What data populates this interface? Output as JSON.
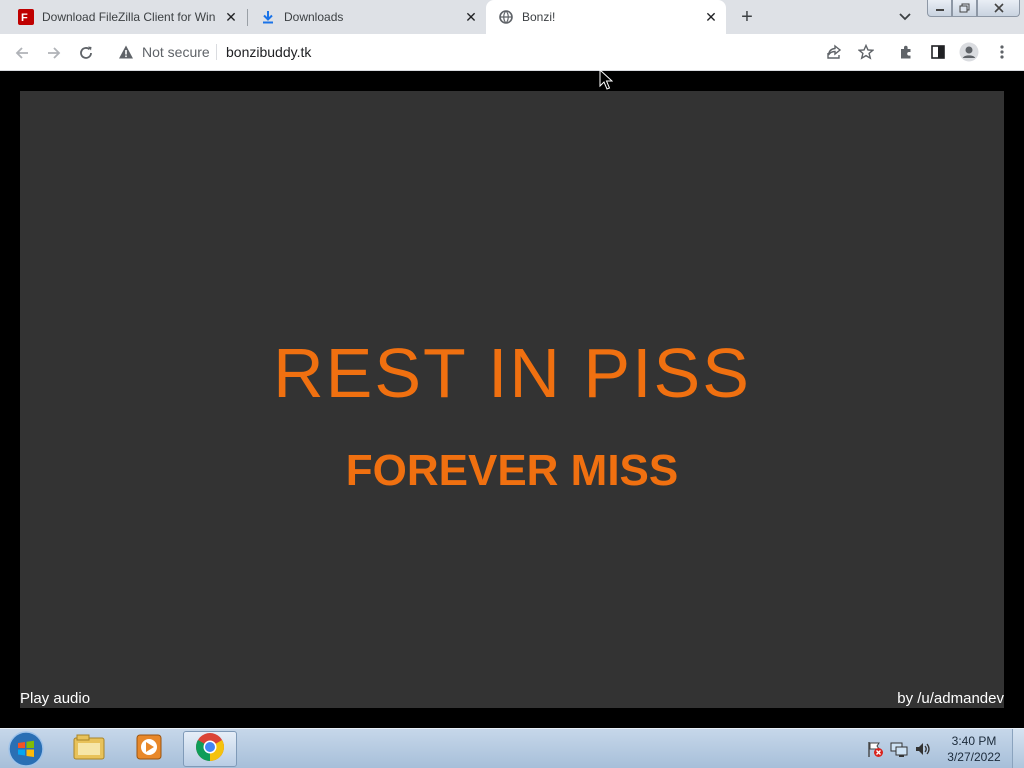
{
  "tabs": [
    {
      "title": "Download FileZilla Client for Win",
      "icon": "filezilla-icon"
    },
    {
      "title": "Downloads",
      "icon": "download-icon"
    },
    {
      "title": "Bonzi!",
      "icon": "globe-icon"
    }
  ],
  "address_bar": {
    "security_label": "Not secure",
    "url": "bonzibuddy.tk"
  },
  "page": {
    "headline": "REST IN PISS",
    "subheadline": "FOREVER MISS",
    "play_audio": "Play audio",
    "credit": "by /u/admandev"
  },
  "colors": {
    "accent_orange": "#f07010",
    "stage_bg": "#333333"
  },
  "taskbar": {
    "apps": [
      "windows-explorer-icon",
      "media-player-icon",
      "chrome-icon"
    ],
    "time": "3:40 PM",
    "date": "3/27/2022"
  }
}
